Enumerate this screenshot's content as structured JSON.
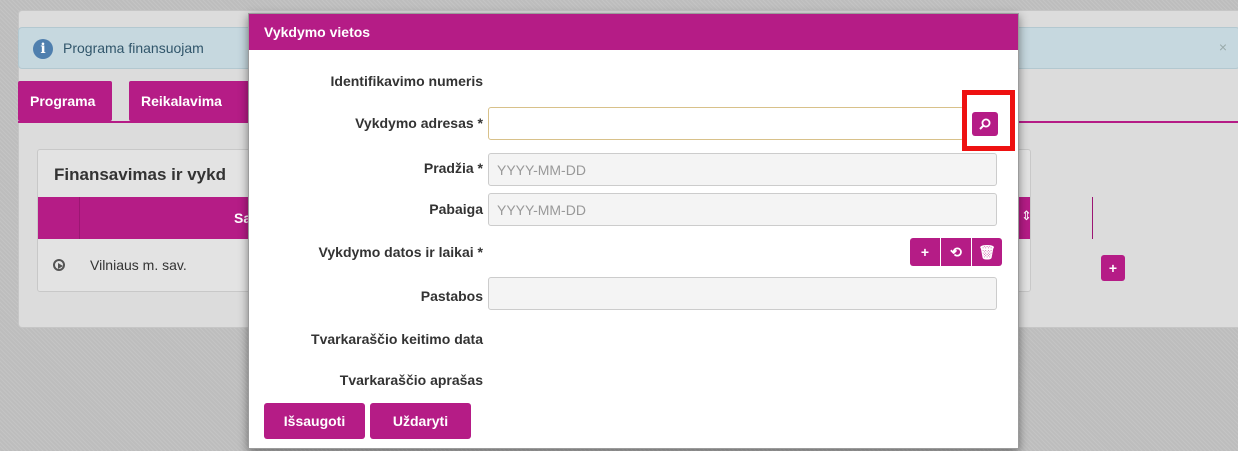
{
  "background": {
    "alert_text": "Programa finansuojam",
    "alert_close": "×",
    "tabs": [
      {
        "label": "Programa"
      },
      {
        "label": "Reikalavima"
      }
    ],
    "card_title": "Finansavimas ir vykd",
    "table_header_partial": "Sa",
    "row_text": "Vilniaus m. sav.",
    "row_add_label": "+"
  },
  "modal": {
    "title": "Vykdymo vietos",
    "fields": {
      "id_label": "Identifikavimo numeris",
      "address_label": "Vykdymo adresas *",
      "address_value": "",
      "start_label": "Pradžia *",
      "start_placeholder": "YYYY-MM-DD",
      "end_label": "Pabaiga",
      "end_placeholder": "YYYY-MM-DD",
      "dates_label": "Vykdymo datos ir laikai *",
      "notes_label": "Pastabos",
      "schedule_change_label": "Tvarkaraščio keitimo data",
      "schedule_desc_label": "Tvarkaraščio aprašas"
    },
    "mini_buttons": [
      "+",
      "⟲",
      "🗑"
    ],
    "buttons": {
      "save": "Išsaugoti",
      "close": "Uždaryti"
    }
  },
  "colors": {
    "accent": "#b51c86",
    "highlight": "#ee1111"
  },
  "icons": [
    "info-icon",
    "search-icon",
    "plus-icon",
    "refresh-icon",
    "trash-icon",
    "expand-icon",
    "sort-icon",
    "close-icon"
  ]
}
